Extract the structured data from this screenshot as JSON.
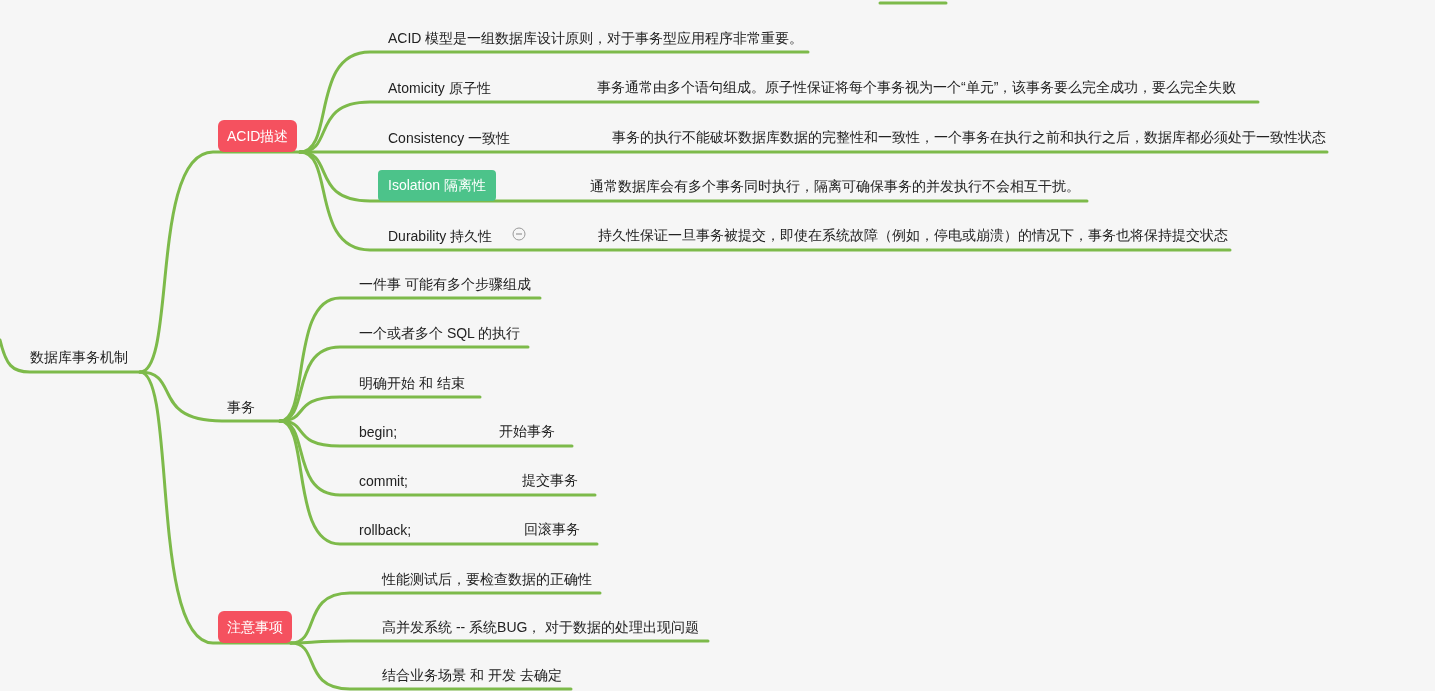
{
  "root": {
    "label": "数据库事务机制"
  },
  "branches": [
    {
      "label": "ACID描述",
      "kind": "tag",
      "children": [
        {
          "label": "ACID 模型是一组数据库设计原则，对于事务型应用程序非常重要。",
          "selected": false,
          "collapse_button": false
        },
        {
          "label": "Atomicity 原子性",
          "detail": "事务通常由多个语句组成。原子性保证将每个事务视为一个“单元”，该事务要么完全成功，要么完全失败",
          "selected": false,
          "collapse_button": false
        },
        {
          "label": "Consistency 一致性",
          "detail": "事务的执行不能破坏数据库数据的完整性和一致性，一个事务在执行之前和执行之后，数据库都必须处于一致性状态",
          "selected": false,
          "collapse_button": false
        },
        {
          "label": "Isolation 隔离性",
          "detail": "通常数据库会有多个事务同时执行，隔离可确保事务的并发执行不会相互干扰。",
          "selected": true,
          "collapse_button": false
        },
        {
          "label": "Durability 持久性",
          "detail": "持久性保证一旦事务被提交，即使在系统故障（例如，停电或崩溃）的情况下，事务也将保持提交状态",
          "selected": false,
          "collapse_button": true
        }
      ]
    },
    {
      "label": "事务",
      "kind": "plain",
      "children": [
        {
          "label": "一件事 可能有多个步骤组成"
        },
        {
          "label": "一个或者多个 SQL 的执行"
        },
        {
          "label": "明确开始 和 结束"
        },
        {
          "label": "begin;",
          "detail": "开始事务"
        },
        {
          "label": "commit;",
          "detail": "提交事务"
        },
        {
          "label": "rollback;",
          "detail": "回滚事务"
        }
      ]
    },
    {
      "label": "注意事项",
      "kind": "tag",
      "children": [
        {
          "label": "性能测试后，要检查数据的正确性"
        },
        {
          "label": "高并发系统 -- 系统BUG， 对于数据的处理出现问题"
        },
        {
          "label": "结合业务场景 和 开发 去确定"
        }
      ]
    }
  ]
}
